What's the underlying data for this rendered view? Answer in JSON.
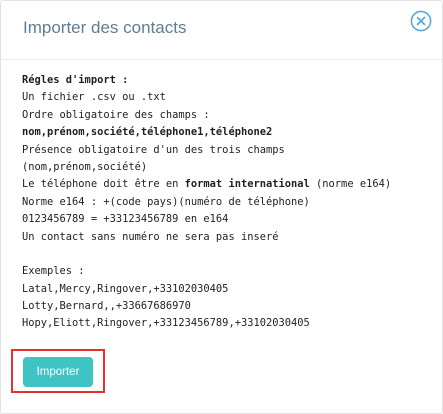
{
  "dialog": {
    "title": "Importer des contacts",
    "close_icon": "close-circle-icon",
    "accent_color": "#3fc4c6",
    "title_color": "#5f7d95"
  },
  "rules": {
    "heading": "Régles d'import :",
    "l1": "Un fichier .csv ou .txt",
    "l2": "Ordre obligatoire des champs :",
    "l3": "nom,prénom,société,téléphone1,téléphone2",
    "l4": "Présence obligatoire d'un des trois champs",
    "l5": "(nom,prénom,société)",
    "l6_pre": "Le téléphone doit être en ",
    "l6_bold": "format international",
    "l6_post": " (norme e164)",
    "l7": "Norme e164 : +(code pays)(numéro de téléphone)",
    "l8": "0123456789 = +33123456789 en e164",
    "l9": "Un contact sans numéro ne sera pas inseré"
  },
  "examples": {
    "heading": "Exemples :",
    "e1": "Latal,Mercy,Ringover,+33102030405",
    "e2": "Lotty,Bernard,,+33667686970",
    "e3": "Hopy,Eliott,Ringover,+33123456789,+33102030405"
  },
  "actions": {
    "import_label": "Importer",
    "highlight_color": "#e5312b"
  }
}
